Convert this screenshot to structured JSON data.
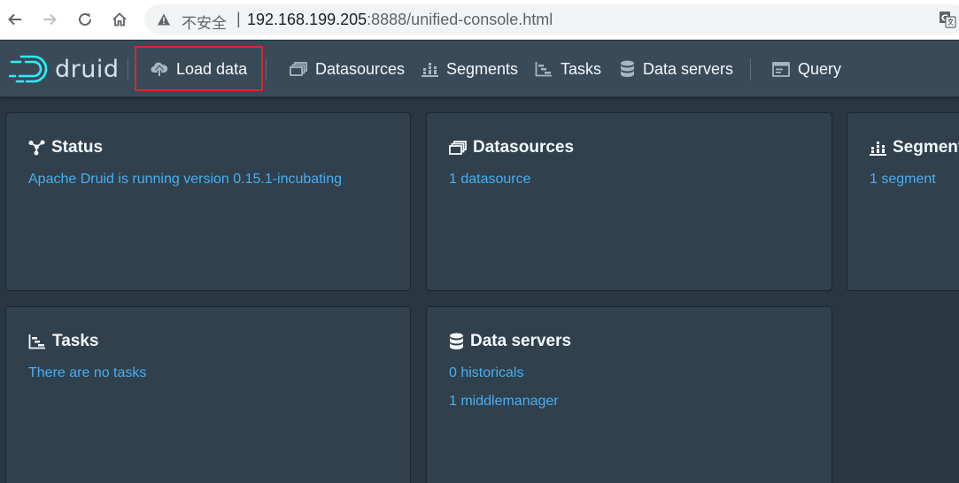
{
  "browser": {
    "insecure_label": "不安全",
    "url_host": "192.168.199.205",
    "url_rest": ":8888/unified-console.html"
  },
  "app": {
    "logo_text": "druid",
    "nav": [
      {
        "label": "Load data",
        "icon": "cloud-upload-icon"
      },
      {
        "label": "Datasources",
        "icon": "multi-select-icon"
      },
      {
        "label": "Segments",
        "icon": "stacked-chart-icon"
      },
      {
        "label": "Tasks",
        "icon": "gantt-chart-icon"
      },
      {
        "label": "Data servers",
        "icon": "database-icon"
      },
      {
        "label": "Query",
        "icon": "application-icon"
      }
    ]
  },
  "cards": {
    "status": {
      "title": "Status",
      "lines": [
        "Apache Druid is running version 0.15.1-incubating"
      ]
    },
    "datasources": {
      "title": "Datasources",
      "lines": [
        "1 datasource"
      ]
    },
    "segments": {
      "title": "Segments",
      "lines": [
        "1 segment"
      ]
    },
    "tasks": {
      "title": "Tasks",
      "lines": [
        "There are no tasks"
      ]
    },
    "data_servers": {
      "title": "Data servers",
      "lines": [
        "0 historicals",
        "1 middlemanager"
      ]
    }
  },
  "colors": {
    "accent": "#48aff0",
    "header_bg": "#394b59",
    "card_bg": "#30404d",
    "page_bg": "#293742",
    "highlight_box": "#e1232a"
  }
}
